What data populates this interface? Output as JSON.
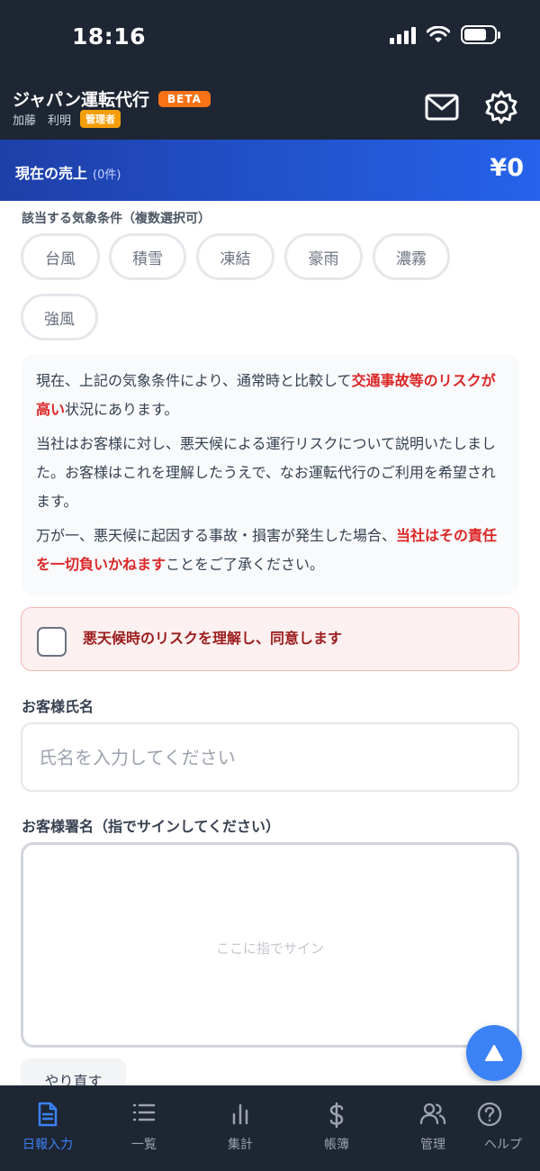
{
  "status": {
    "time": "18:16"
  },
  "header": {
    "app_title": "ジャパン運転代行",
    "beta_label": "BETA",
    "user_name": "加藤　利明",
    "role_label": "管理者",
    "mail_icon": "mail-icon",
    "settings_icon": "gear-icon"
  },
  "sales": {
    "label": "現在の売上",
    "count": "(0件)",
    "amount": "¥0"
  },
  "weather": {
    "label": "該当する気象条件（複数選択可）",
    "options": [
      "台風",
      "積雪",
      "凍結",
      "豪雨",
      "濃霧",
      "強風"
    ]
  },
  "notice": {
    "p1_a": "現在、上記の気象条件により、通常時と比較して",
    "p1_red": "交通事故等のリスクが高い",
    "p1_b": "状況にあります。",
    "p2": "当社はお客様に対し、悪天候による運行リスクについて説明いたしました。お客様はこれを理解したうえで、なお運転代行のご利用を希望されます。",
    "p3_a": "万が一、悪天候に起因する事故・損害が発生した場合、",
    "p3_red": "当社はその責任を一切負いかねます",
    "p3_b": "ことをご了承ください。"
  },
  "agree": {
    "label": "悪天候時のリスクを理解し、同意します",
    "checked": false
  },
  "customer_name": {
    "label": "お客様氏名",
    "placeholder": "氏名を入力してください",
    "value": ""
  },
  "signature": {
    "label": "お客様署名（指でサインしてください）",
    "hint": "ここに指でサイン",
    "retry_label": "やり直す"
  },
  "colors": {
    "header_bg": "#1e2533",
    "accent": "#2563eb",
    "warning": "#dc2626",
    "beta": "#f97316",
    "role": "#f59e0b"
  },
  "nav": {
    "items": [
      {
        "label": "日報入力",
        "icon": "document-icon",
        "active": true
      },
      {
        "label": "一覧",
        "icon": "list-icon",
        "active": false
      },
      {
        "label": "集計",
        "icon": "bar-chart-icon",
        "active": false
      },
      {
        "label": "帳簿",
        "icon": "dollar-icon",
        "active": false
      },
      {
        "label": "管理",
        "icon": "users-icon",
        "active": false
      },
      {
        "label": "ヘルプ",
        "icon": "help-icon",
        "active": false
      }
    ]
  }
}
